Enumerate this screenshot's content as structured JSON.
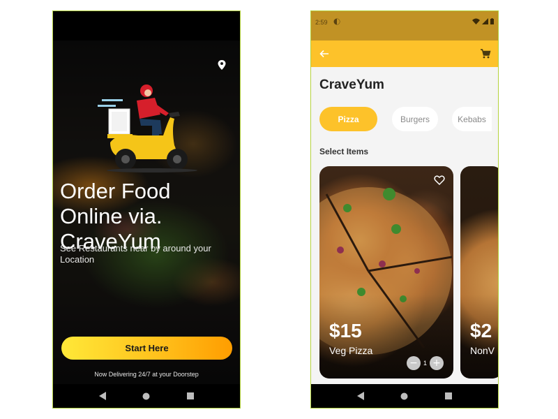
{
  "colors": {
    "accent": "#fdc22a",
    "status_bar": "#c19225",
    "button_gradient_start": "#ffe838",
    "button_gradient_end": "#ff9d00"
  },
  "onboarding": {
    "icons": [
      "location-pin-icon",
      "delivery-scooter-illustration"
    ],
    "title": "Order Food Online via. CraveYum",
    "subtitle": "See Restaurants near by around your Location",
    "start_button": "Start Here",
    "footer": "Now Delivering 24/7 at your Doorstep"
  },
  "menu_screen": {
    "status_bar": {
      "time": "2:59"
    },
    "toolbar": {
      "icons": [
        "back-arrow-icon",
        "cart-icon"
      ]
    },
    "title": "CraveYum",
    "categories": [
      {
        "label": "Pizza",
        "active": true
      },
      {
        "label": "Burgers",
        "active": false
      },
      {
        "label": "Kebabs",
        "active": false
      }
    ],
    "section_label": "Select Items",
    "items": [
      {
        "price": "$15",
        "name": "Veg Pizza",
        "quantity": "1"
      },
      {
        "price": "$2",
        "name": "NonV"
      }
    ]
  },
  "nav_bar": {
    "icons": [
      "back-triangle-icon",
      "home-circle-icon",
      "recents-square-icon"
    ]
  }
}
